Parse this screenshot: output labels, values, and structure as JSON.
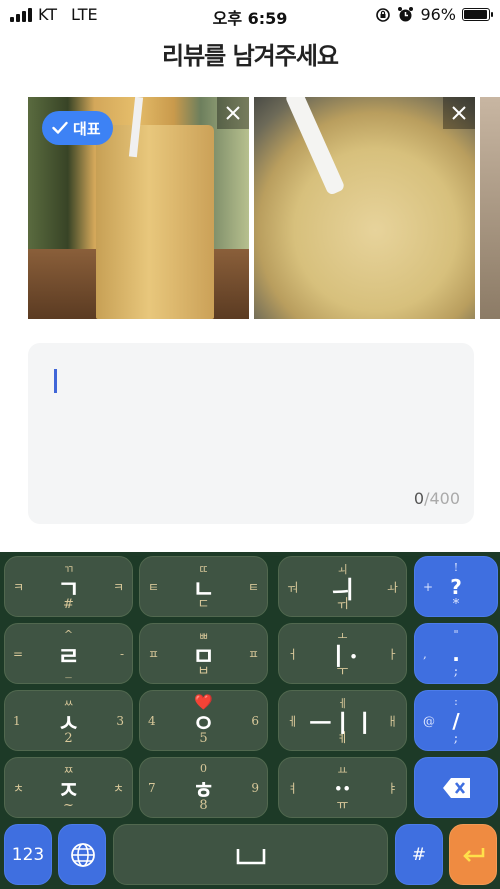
{
  "status_bar": {
    "carrier": "KT",
    "network": "LTE",
    "time": "오후 6:59",
    "battery_percent": "96%",
    "battery_level": 0.96
  },
  "title": "리뷰를 남겨주세요",
  "photos": {
    "badge_label": "대표",
    "icons": [
      "check-icon",
      "close-icon"
    ]
  },
  "review": {
    "count_current": "0",
    "count_max": "/400"
  },
  "keyboard": {
    "keys": [
      {
        "name": "key-giyeok",
        "main": "ㄱ",
        "top": "ㄲ",
        "bottom": "#",
        "left": "ㅋ",
        "right": "ㅋ"
      },
      {
        "name": "key-nieun",
        "main": "ㄴ",
        "top": "ㄸ",
        "bottom": "ㄷ",
        "left": "ㅌ",
        "right": "ㅌ"
      },
      {
        "name": "key-vowel-1",
        "main": "ㅢ",
        "top": "ㅚ",
        "bottom": "ㅟ",
        "left": "ㅝ",
        "right": "ㅘ"
      },
      {
        "name": "key-punct-1",
        "main": "?",
        "top": "!",
        "bottom": "*",
        "left": "+",
        "right": ""
      },
      {
        "name": "key-rieul",
        "main": "ㄹ",
        "top": "^",
        "bottom": "_",
        "left": "=",
        "right": "-"
      },
      {
        "name": "key-mieum",
        "main": "ㅁ",
        "top": "ㅃ",
        "bottom": "ㅂ",
        "left": "ㅍ",
        "right": "ㅍ"
      },
      {
        "name": "key-vowel-2",
        "main": "ㅣ·",
        "top": "ㅗ",
        "bottom": "ㅜ",
        "left": "ㅓ",
        "right": "ㅏ"
      },
      {
        "name": "key-punct-2",
        "main": ".",
        "top": "\"",
        "bottom": ";",
        "left": ",",
        "right": ""
      },
      {
        "name": "key-siot",
        "main": "ㅅ",
        "top": "ㅆ",
        "bottom": "2",
        "left": "1",
        "right": "3"
      },
      {
        "name": "key-ieung",
        "main": "ㅇ",
        "top": "",
        "bottom": "5",
        "left": "4",
        "right": "6"
      },
      {
        "name": "key-vowel-3",
        "main": "ㅡㅣㅣ",
        "top": "ㅔ",
        "bottom": "ㅖ",
        "left": "ㅔ",
        "right": "ㅐ"
      },
      {
        "name": "key-punct-3",
        "main": "/",
        "top": ":",
        "bottom": ";",
        "left": "@",
        "right": ""
      },
      {
        "name": "key-jieut",
        "main": "ㅈ",
        "top": "ㅉ",
        "bottom": "~",
        "left": "ㅊ",
        "right": "ㅊ"
      },
      {
        "name": "key-hieut",
        "main": "ㅎ",
        "top": "0",
        "bottom": "8",
        "left": "7",
        "right": "9"
      },
      {
        "name": "key-vowel-4",
        "main": "··",
        "top": "ㅛ",
        "bottom": "ㅠ",
        "left": "ㅕ",
        "right": "ㅑ"
      }
    ],
    "num_label": "123",
    "hash_label": "#",
    "heart": "❤️"
  }
}
